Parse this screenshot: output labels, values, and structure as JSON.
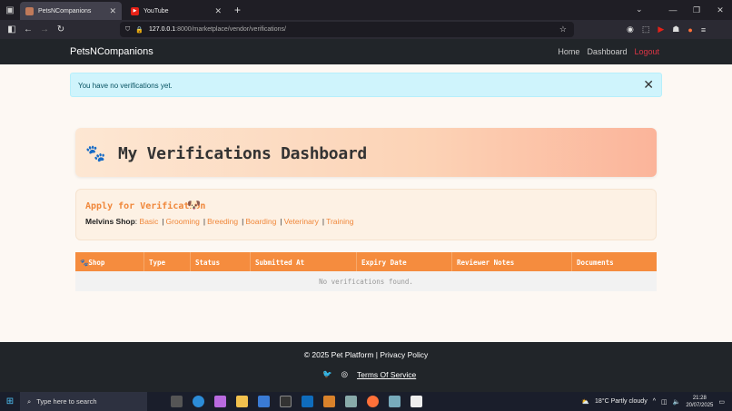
{
  "browser": {
    "tabs": [
      {
        "title": "PetsNCompanions",
        "active": true
      },
      {
        "title": "YouTube",
        "active": false
      }
    ],
    "url_host": "127.0.0.1",
    "url_path": ":8000/marketplace/vendor/verifications/"
  },
  "site": {
    "brand": "PetsNCompanions",
    "nav": [
      "Home",
      "Dashboard",
      "Logout"
    ]
  },
  "alert": {
    "message": "You have no verifications yet."
  },
  "banner": {
    "title": "My Verifications Dashboard"
  },
  "apply": {
    "title": "Apply for Verification",
    "shop_name": "Melvins Shop",
    "types": [
      "Basic",
      "Grooming",
      "Breeding",
      "Boarding",
      "Veterinary",
      "Training"
    ]
  },
  "table": {
    "columns": [
      "Shop",
      "Type",
      "Status",
      "Submitted At",
      "Expiry Date",
      "Reviewer Notes",
      "Documents"
    ],
    "empty_message": "No verifications found."
  },
  "footer": {
    "copyright": "© 2025 Pet Platform | ",
    "privacy": "Privacy Policy",
    "terms": "Terms Of Service"
  },
  "taskbar": {
    "search_placeholder": "Type here to search",
    "weather": "18°C  Partly cloudy",
    "time": "21:28",
    "date": "20/07/2025"
  },
  "colors": {
    "accent": "#f58c3e",
    "header_bg": "#212529",
    "alert_bg": "#cff4fc",
    "logout": "#dc3545"
  }
}
